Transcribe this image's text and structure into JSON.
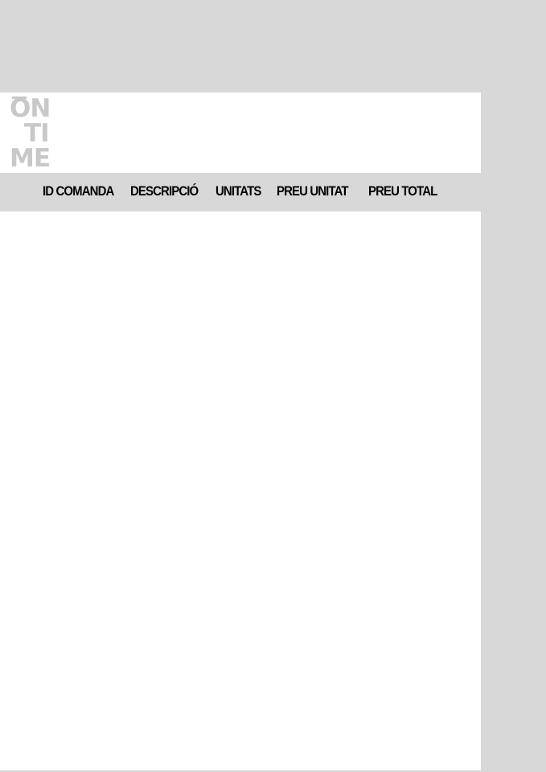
{
  "logo": {
    "line1": "ON",
    "line2": "TI",
    "line3": "ME"
  },
  "table": {
    "headers": [
      "ID COMANDA",
      "DESCRIPCIÓ",
      "UNITATS",
      "PREU UNITAT",
      "PREU TOTAL"
    ],
    "rows": []
  },
  "colors": {
    "background": "#d8d8d8",
    "sheet": "#ffffff",
    "logo": "#c8c8c8",
    "header_band": "#d8d8d8",
    "header_text": "#000000"
  }
}
